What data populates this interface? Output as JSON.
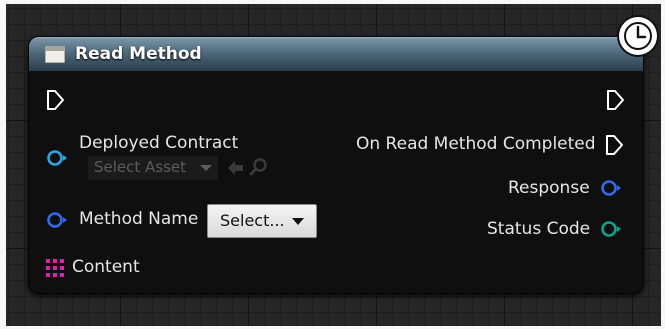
{
  "node": {
    "title": "Read Method",
    "header_color": "#4e6a7d",
    "icons": {
      "header": "blueprint-function-icon",
      "badge": "clock-icon",
      "exec_in": "exec-pin-icon",
      "exec_out": "exec-pin-icon"
    }
  },
  "inputs": {
    "deployed_contract": {
      "label": "Deployed Contract",
      "dropdown_value": "Select Asset",
      "pin_color": "#2aa7e8",
      "actions": [
        "use-selected-asset-icon",
        "browse-asset-icon"
      ]
    },
    "method_name": {
      "label": "Method Name",
      "dropdown_value": "Select...",
      "pin_color": "#2f6be8"
    },
    "content": {
      "label": "Content",
      "pin_color": "#e31fb3"
    }
  },
  "outputs": {
    "completed": {
      "label": "On Read Method Completed"
    },
    "response": {
      "label": "Response",
      "pin_color": "#2f6be8"
    },
    "status_code": {
      "label": "Status Code",
      "pin_color": "#0fa38a"
    }
  }
}
